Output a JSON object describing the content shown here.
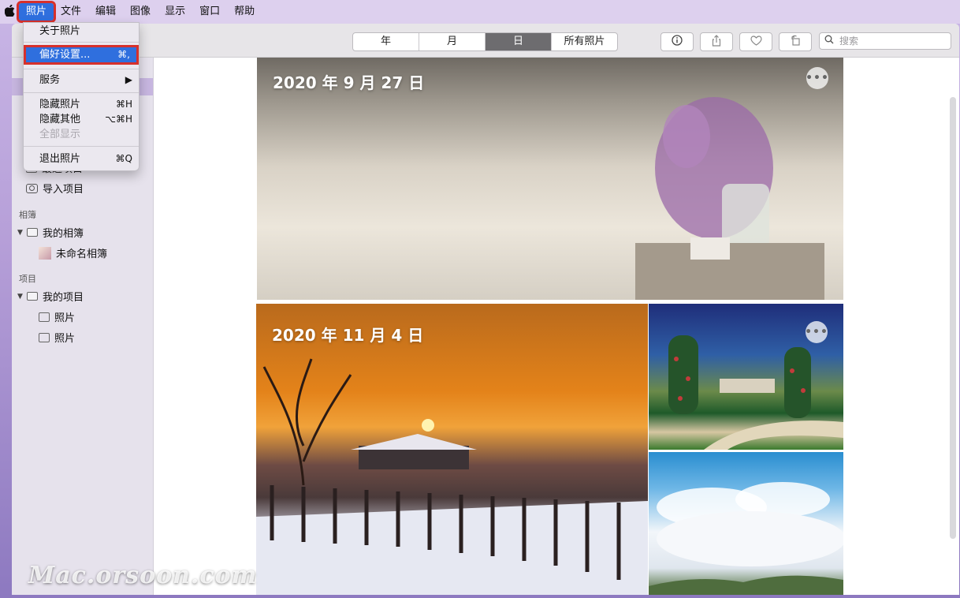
{
  "menubar": {
    "apple": "",
    "items": [
      "照片",
      "文件",
      "编辑",
      "图像",
      "显示",
      "窗口",
      "帮助"
    ]
  },
  "dropdown": {
    "about": "关于照片",
    "preferences": "偏好设置...",
    "preferences_shortcut": "⌘,",
    "services": "服务",
    "services_arrow": "▶",
    "hide": "隐藏照片",
    "hide_shortcut": "⌘H",
    "hide_others": "隐藏其他",
    "hide_others_shortcut": "⌥⌘H",
    "show_all": "全部显示",
    "quit": "退出照片",
    "quit_shortcut": "⌘Q"
  },
  "toolbar": {
    "tabs": [
      "年",
      "月",
      "日",
      "所有照片"
    ],
    "selected_tab": "日",
    "search_placeholder": "搜索"
  },
  "sidebar": {
    "recent": "最近项目",
    "imports": "导入项目",
    "albums_header": "相簿",
    "my_albums": "我的相簿",
    "untitled_album": "未命名相簿",
    "projects_header": "项目",
    "my_projects": "我的项目",
    "project_1": "照片",
    "project_2": "照片"
  },
  "content": {
    "date_1": "2020 年 9 月 27 日",
    "date_2": "2020 年 11 月 4 日",
    "more": "•••"
  },
  "watermark": "Mac.orsoon.com"
}
